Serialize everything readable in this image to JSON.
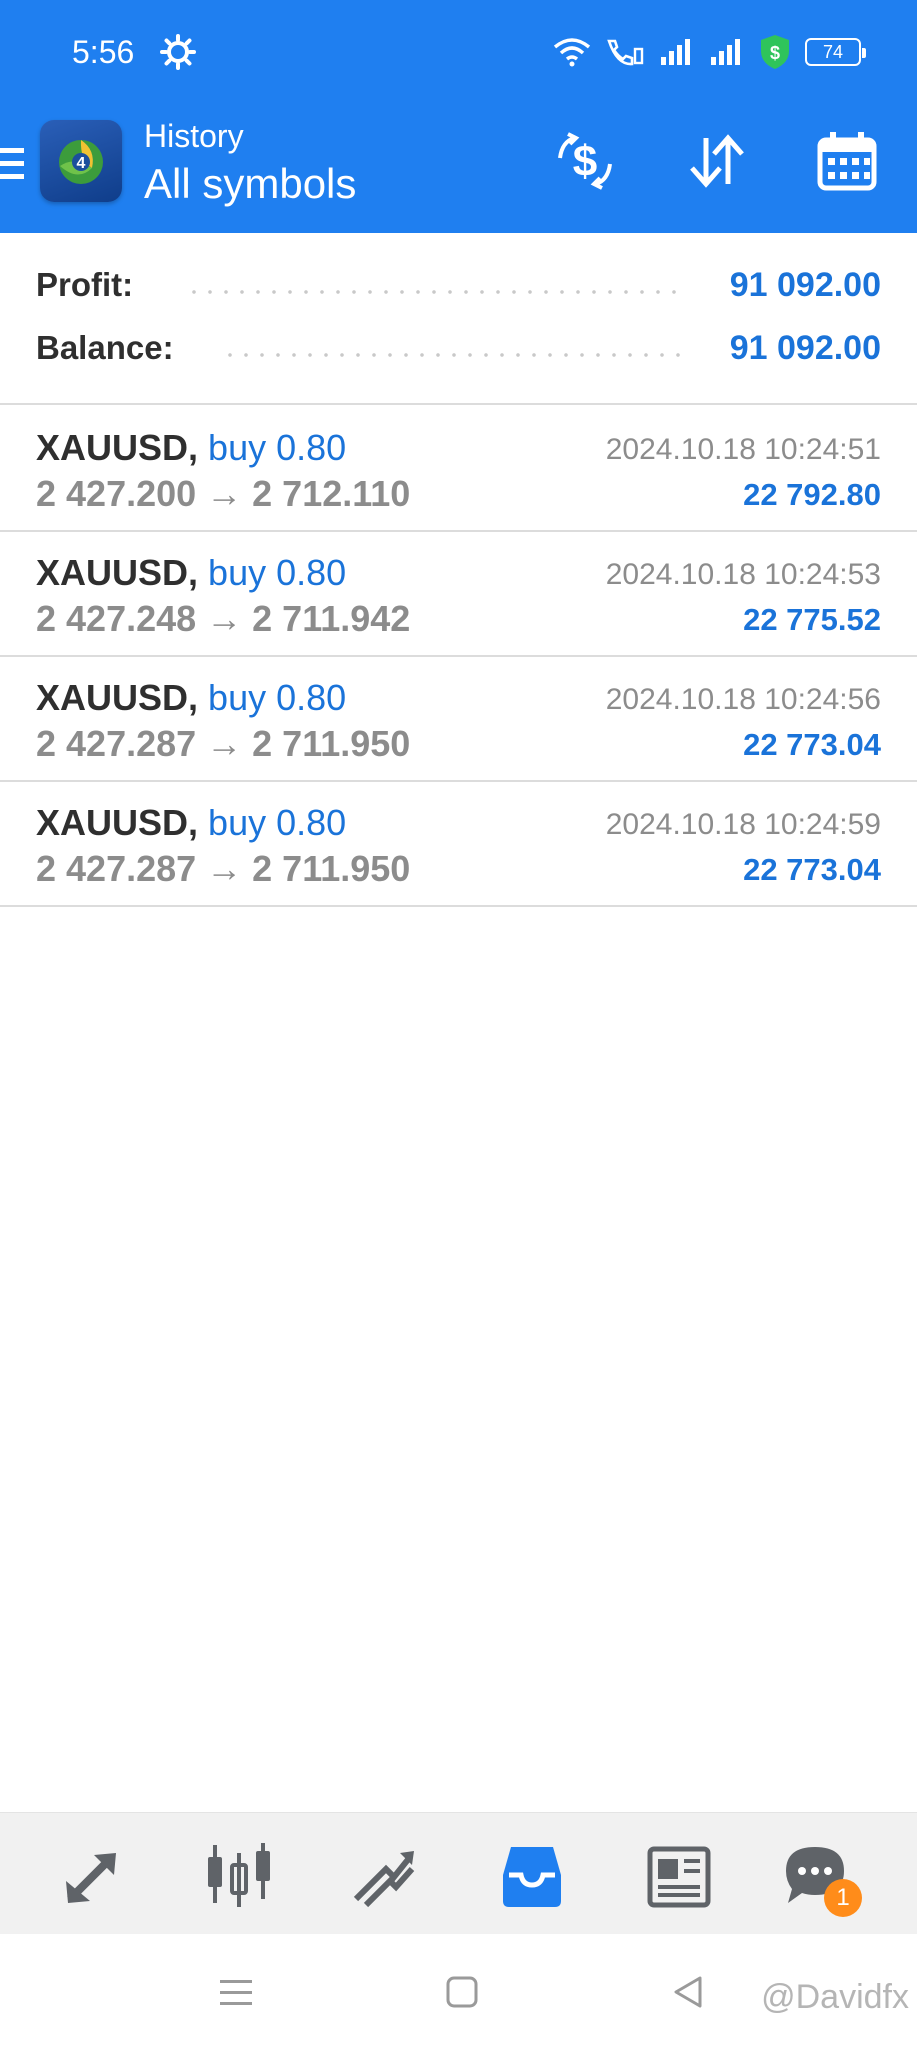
{
  "status_bar": {
    "time": "5:56",
    "battery": "74",
    "icons": [
      "gear-icon",
      "wifi-icon",
      "call-icon",
      "signal-icon",
      "signal-icon",
      "shield-icon",
      "battery-icon"
    ]
  },
  "header": {
    "subtitle": "History",
    "title": "All symbols",
    "actions": [
      "currency-exchange-icon",
      "sort-icon",
      "calendar-icon"
    ]
  },
  "summary": {
    "profit_label": "Profit:",
    "profit_value": "91 092.00",
    "balance_label": "Balance:",
    "balance_value": "91 092.00"
  },
  "deals": [
    {
      "symbol": "XAUUSD,",
      "side": "buy 0.80",
      "prices": "2 427.200 → 2 712.110",
      "time": "2024.10.18 10:24:51",
      "profit": "22 792.80"
    },
    {
      "symbol": "XAUUSD,",
      "side": "buy 0.80",
      "prices": "2 427.248 → 2 711.942",
      "time": "2024.10.18 10:24:53",
      "profit": "22 775.52"
    },
    {
      "symbol": "XAUUSD,",
      "side": "buy 0.80",
      "prices": "2 427.287 → 2 711.950",
      "time": "2024.10.18 10:24:56",
      "profit": "22 773.04"
    },
    {
      "symbol": "XAUUSD,",
      "side": "buy 0.80",
      "prices": "2 427.287 → 2 711.950",
      "time": "2024.10.18 10:24:59",
      "profit": "22 773.04"
    }
  ],
  "bottom_nav": {
    "items": [
      "quotes-icon",
      "chart-icon",
      "trade-icon",
      "history-icon",
      "news-icon",
      "chat-icon"
    ],
    "active": "history-icon",
    "chat_badge": "1"
  },
  "watermark": "@Davidfx",
  "colors": {
    "primary": "#1f7ff0",
    "value_blue": "#1a73d9",
    "badge": "#ff8c1a"
  }
}
